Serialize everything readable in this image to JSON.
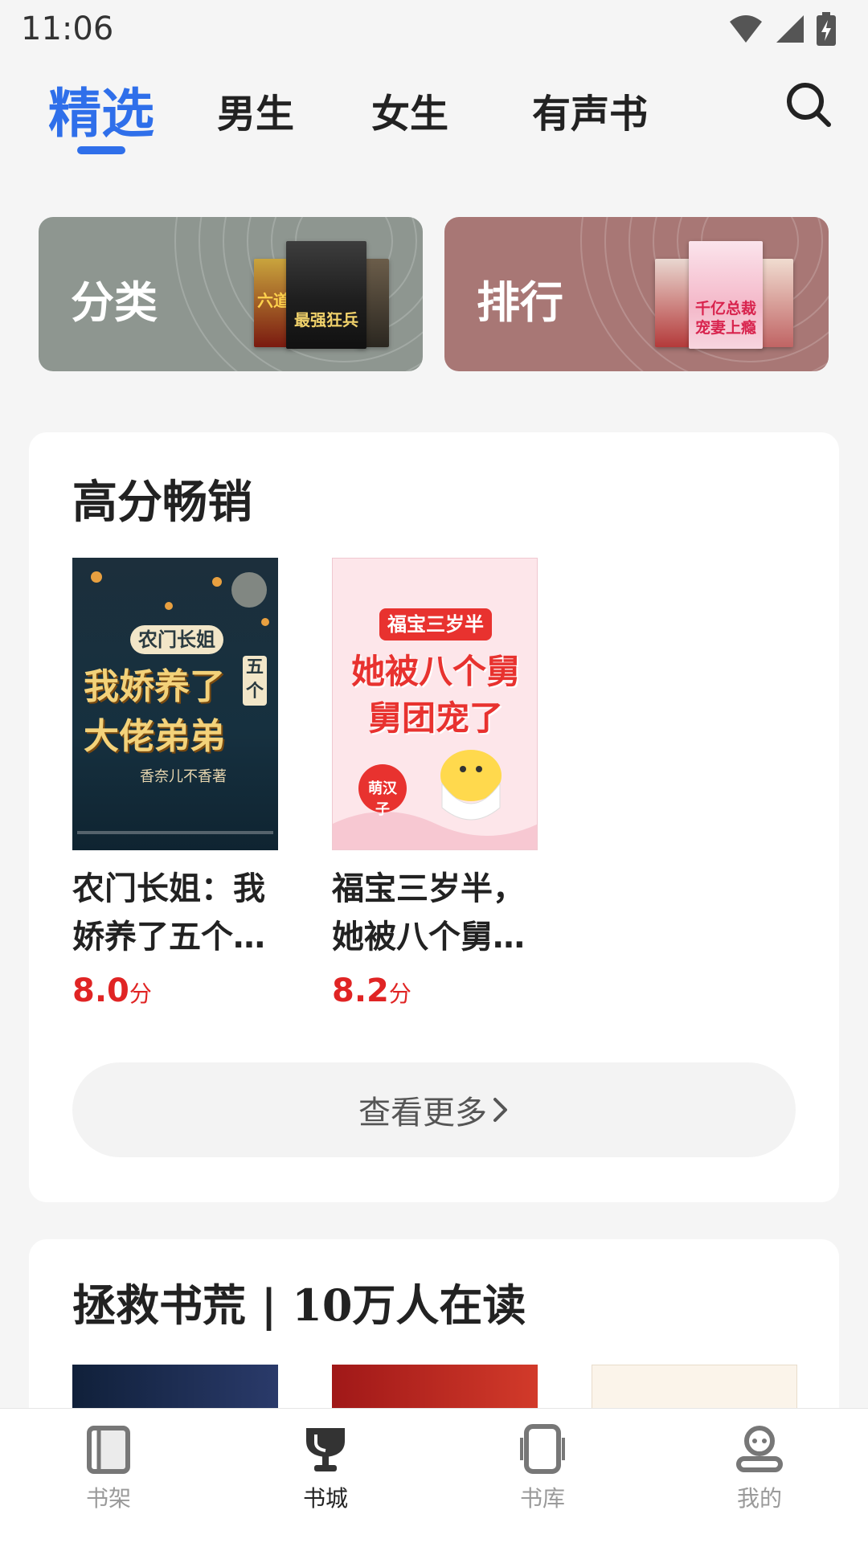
{
  "status_bar": {
    "time": "11:06"
  },
  "top_tabs": {
    "active": "精选",
    "items": [
      "男生",
      "女生",
      "有声书"
    ]
  },
  "categories": [
    {
      "label": "分类",
      "color": "#8e9690"
    },
    {
      "label": "排行",
      "color": "#a87775"
    }
  ],
  "mini_cover_text": {
    "fenlei_main": "最强狂兵",
    "fenlei_left": "六道",
    "paihang_main": "千亿总裁宠妻上瘾"
  },
  "section_high": {
    "title": "高分畅销",
    "books": [
      {
        "title": "农门长姐：我娇养了五个…",
        "score": "8.0",
        "unit": "分",
        "cover_tag": "农门长姐",
        "cover_main": "我娇养了大佬弟弟",
        "cover_side": "五个",
        "cover_author": "香奈儿不香著"
      },
      {
        "title": "福宝三岁半，她被八个舅…",
        "score": "8.2",
        "unit": "分",
        "cover_tag": "福宝三岁半",
        "cover_main": "她被八个舅舅团宠了",
        "cover_author": "萌汉子"
      }
    ],
    "more_label": "查看更多"
  },
  "section_rescue": {
    "title": "拯救书荒 | 10万人在读"
  },
  "bottom_nav": [
    {
      "label": "书架",
      "icon": "bookshelf-icon",
      "active": false
    },
    {
      "label": "书城",
      "icon": "trophy-icon",
      "active": true
    },
    {
      "label": "书库",
      "icon": "tablet-icon",
      "active": false
    },
    {
      "label": "我的",
      "icon": "profile-icon",
      "active": false
    }
  ],
  "colors": {
    "accent": "#2f6fea",
    "score": "#e02424"
  }
}
